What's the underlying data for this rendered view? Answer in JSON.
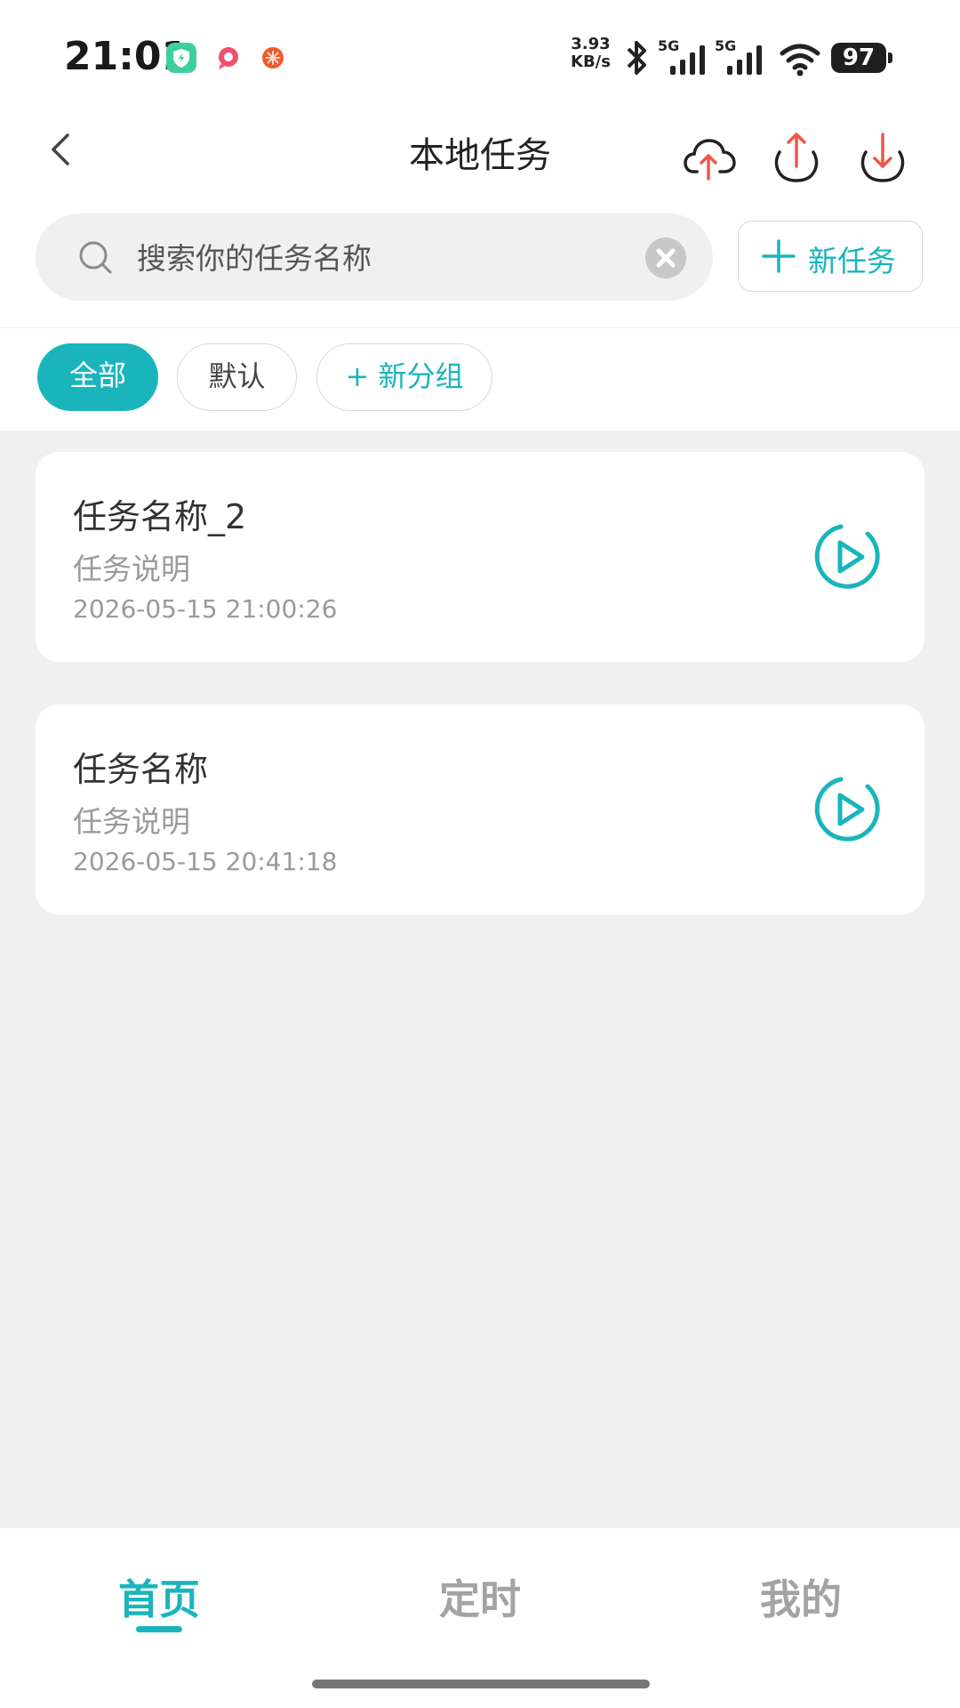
{
  "status_bar": {
    "time": "21:01",
    "net_speed_value": "3.93",
    "net_speed_unit": "KB/s",
    "signal1_label": "5G",
    "signal2_label": "5G",
    "battery": "97",
    "icons": [
      "shield-app-icon",
      "chat-app-icon",
      "orange-app-icon",
      "bluetooth-icon",
      "signal-icon",
      "wifi-icon",
      "battery-icon"
    ]
  },
  "header": {
    "title": "本地任务",
    "icons": [
      "back-icon",
      "cloud-upload-icon",
      "upload-icon",
      "download-icon"
    ]
  },
  "search": {
    "placeholder": "搜索你的任务名称",
    "value": ""
  },
  "new_task_button": {
    "label": "新任务"
  },
  "filters": {
    "all": "全部",
    "default": "默认",
    "new_group": "+ 新分组",
    "selected": "全部"
  },
  "tasks": [
    {
      "name": "任务名称_2",
      "desc": "任务说明",
      "time": "2026-05-15 21:00:26"
    },
    {
      "name": "任务名称",
      "desc": "任务说明",
      "time": "2026-05-15 20:41:18"
    }
  ],
  "bottom_nav": {
    "home": "首页",
    "timer": "定时",
    "mine": "我的",
    "active": "首页"
  },
  "colors": {
    "accent": "#1ab5bc",
    "upload_arrow": "#f0564a",
    "background": "#f0f0f0"
  }
}
